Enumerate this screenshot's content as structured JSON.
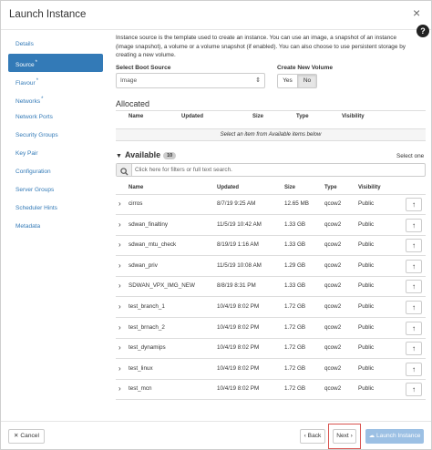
{
  "window": {
    "title": "Launch Instance",
    "close_symbol": "×",
    "help_symbol": "?"
  },
  "sidebar": {
    "items": [
      {
        "label": "Details",
        "required": ""
      },
      {
        "label": "Source",
        "required": "*"
      },
      {
        "label": "Flavour",
        "required": "*"
      },
      {
        "label": "Networks",
        "required": "*"
      },
      {
        "label": "Network Ports",
        "required": ""
      },
      {
        "label": "Security Groups",
        "required": ""
      },
      {
        "label": "Key Pair",
        "required": ""
      },
      {
        "label": "Configuration",
        "required": ""
      },
      {
        "label": "Server Groups",
        "required": ""
      },
      {
        "label": "Scheduler Hints",
        "required": ""
      },
      {
        "label": "Metadata",
        "required": ""
      }
    ],
    "active_index": 1
  },
  "source": {
    "description": "Instance source is the template used to create an instance. You can use an image, a snapshot of an instance (image snapshot), a volume or a volume snapshot (if enabled). You can also choose to use persistent storage by creating a new volume.",
    "boot_source_label": "Select Boot Source",
    "boot_source_value": "Image",
    "new_volume_label": "Create New Volume",
    "yes_label": "Yes",
    "no_label": "No",
    "new_volume_selected": "No"
  },
  "allocated": {
    "heading": "Allocated",
    "columns": [
      "Name",
      "Updated",
      "Size",
      "Type",
      "Visibility"
    ],
    "empty_text": "Select an item from Available items below"
  },
  "available": {
    "heading": "Available",
    "count": "10",
    "select_hint": "Select one",
    "search_placeholder": "Click here for filters or full text search.",
    "columns": [
      "Name",
      "Updated",
      "Size",
      "Type",
      "Visibility"
    ],
    "rows": [
      {
        "name": "cirros",
        "updated": "8/7/19 9:25 AM",
        "size": "12.65 MB",
        "type": "qcow2",
        "visibility": "Public"
      },
      {
        "name": "sdwan_finaltiny",
        "updated": "11/5/19 10:42 AM",
        "size": "1.33 GB",
        "type": "qcow2",
        "visibility": "Public"
      },
      {
        "name": "sdwan_mtu_check",
        "updated": "8/19/19 1:16 AM",
        "size": "1.33 GB",
        "type": "qcow2",
        "visibility": "Public"
      },
      {
        "name": "sdwan_priv",
        "updated": "11/5/19 10:08 AM",
        "size": "1.29 GB",
        "type": "qcow2",
        "visibility": "Public"
      },
      {
        "name": "SDWAN_VPX_IMG_NEW",
        "updated": "8/8/19 8:31 PM",
        "size": "1.33 GB",
        "type": "qcow2",
        "visibility": "Public"
      },
      {
        "name": "test_branch_1",
        "updated": "10/4/19 8:02 PM",
        "size": "1.72 GB",
        "type": "qcow2",
        "visibility": "Public"
      },
      {
        "name": "test_brnach_2",
        "updated": "10/4/19 8:02 PM",
        "size": "1.72 GB",
        "type": "qcow2",
        "visibility": "Public"
      },
      {
        "name": "test_dynamips",
        "updated": "10/4/19 8:02 PM",
        "size": "1.72 GB",
        "type": "qcow2",
        "visibility": "Public"
      },
      {
        "name": "test_linux",
        "updated": "10/4/19 8:02 PM",
        "size": "1.72 GB",
        "type": "qcow2",
        "visibility": "Public"
      },
      {
        "name": "test_mcn",
        "updated": "10/4/19 8:02 PM",
        "size": "1.72 GB",
        "type": "qcow2",
        "visibility": "Public"
      }
    ]
  },
  "footer": {
    "cancel_label": "✕ Cancel",
    "back_label": "‹ Back",
    "next_label": "Next ›",
    "launch_label": "Launch Instance"
  },
  "colors": {
    "accent": "#337ab7",
    "launch_disabled": "#9cc0e4",
    "highlight": "#d9534f"
  }
}
